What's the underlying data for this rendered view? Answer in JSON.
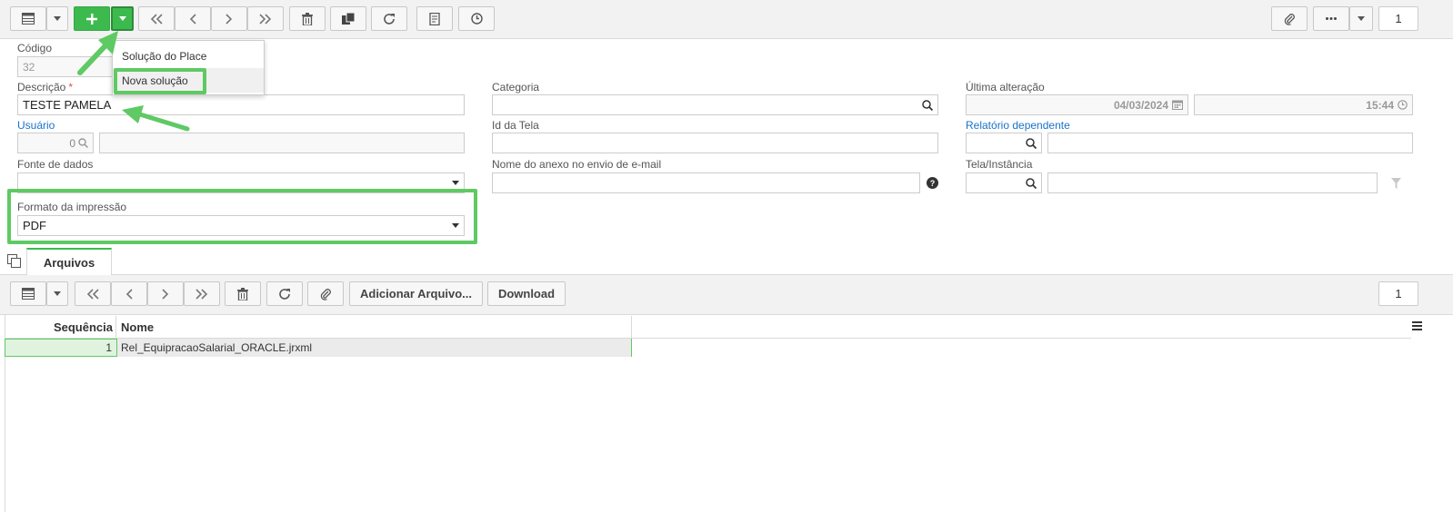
{
  "toolbar": {
    "counter": "1"
  },
  "dropdown_menu": {
    "items": [
      "Solução do Place",
      "Nova solução"
    ]
  },
  "form": {
    "codigo": {
      "label": "Código",
      "value": "32"
    },
    "descricao": {
      "label": "Descrição",
      "required_mark": "*",
      "value": "TESTE PAMELA"
    },
    "usuario": {
      "label": "Usuário",
      "value": "0"
    },
    "fonte_dados": {
      "label": "Fonte de dados",
      "value": ""
    },
    "formato": {
      "label": "Formato da impressão",
      "value": "PDF"
    },
    "categoria": {
      "label": "Categoria",
      "value": ""
    },
    "id_tela": {
      "label": "Id da Tela",
      "value": ""
    },
    "nome_anexo": {
      "label": "Nome do anexo no envio de e-mail",
      "value": ""
    },
    "ultima_alteracao": {
      "label": "Última alteração",
      "date": "04/03/2024",
      "time": "15:44"
    },
    "relatorio_dependente": {
      "label": "Relatório dependente"
    },
    "tela_instancia": {
      "label": "Tela/Instância"
    }
  },
  "tabs": [
    {
      "label": "Arquivos",
      "active": true
    }
  ],
  "files_toolbar": {
    "add_label": "Adicionar Arquivo...",
    "download_label": "Download",
    "counter": "1"
  },
  "grid": {
    "columns": [
      "Sequência",
      "Nome"
    ],
    "rows": [
      {
        "seq": "1",
        "name": "Rel_EquipracaoSalarial_ORACLE.jrxml"
      }
    ]
  },
  "colors": {
    "accent_green": "#3dba4e",
    "highlight_green": "#5fc964",
    "link_blue": "#1a73c9"
  }
}
